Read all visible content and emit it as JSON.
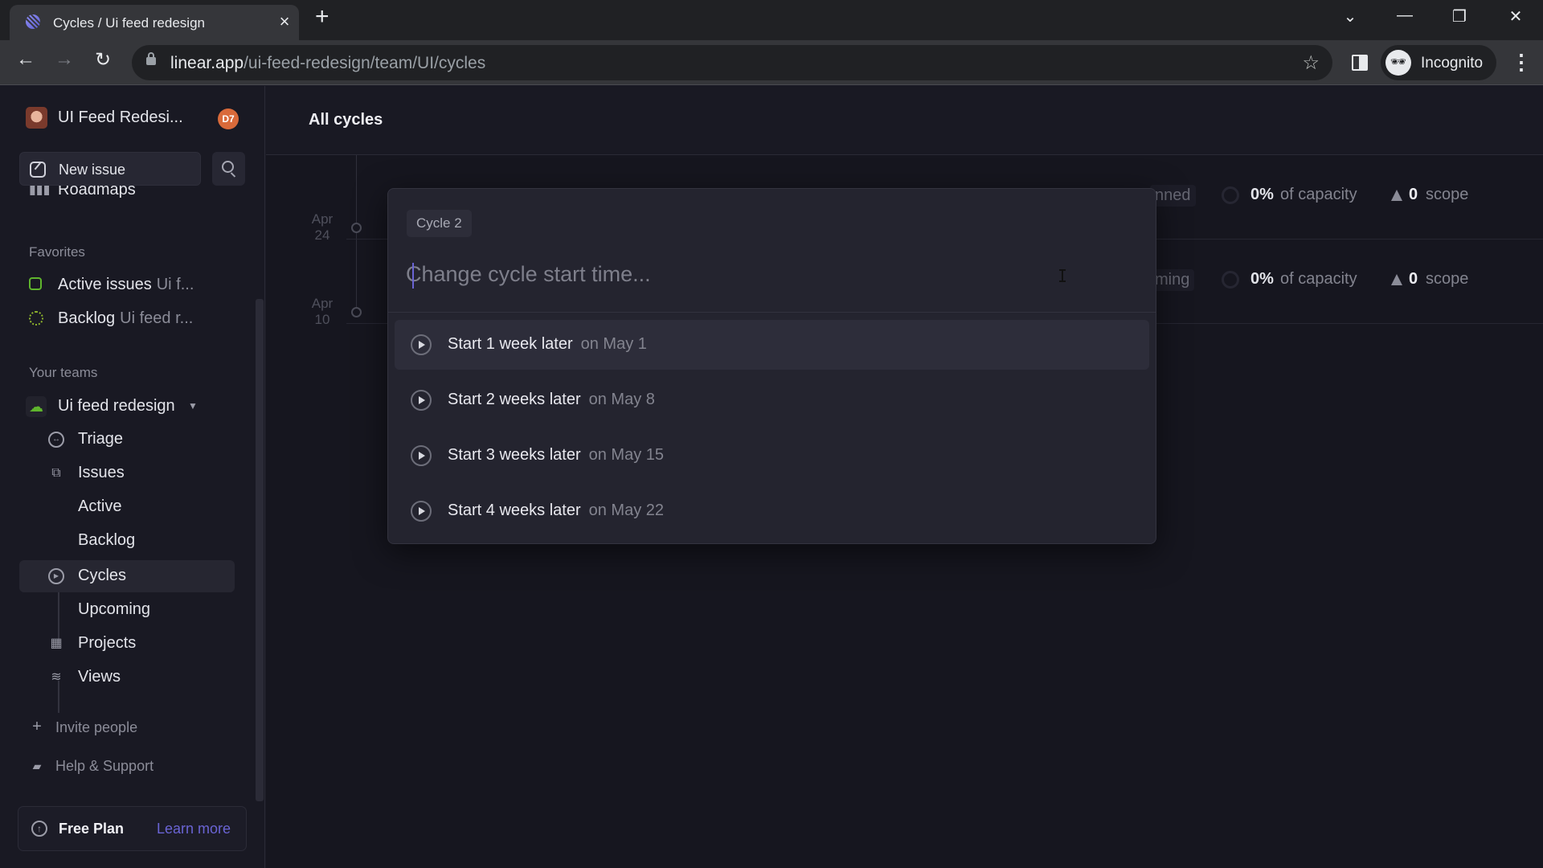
{
  "browser": {
    "tab_title": "Cycles / Ui feed redesign",
    "tab_close": "×",
    "new_tab": "+",
    "url_host": "linear.app",
    "url_path": "/ui-feed-redesign/team/UI/cycles",
    "profile_label": "Incognito",
    "controls": {
      "dropdown": "⌄",
      "minimize": "—",
      "restore": "❐",
      "close": "✕"
    },
    "nav": {
      "back": "←",
      "forward": "→",
      "reload": "↻",
      "star": "☆",
      "menu": "⋮"
    }
  },
  "sidebar": {
    "workspace_name": "UI Feed Redesi...",
    "user_badge": "D7",
    "new_issue_label": "New issue",
    "roadmaps_label": "Roadmaps",
    "favorites_heading": "Favorites",
    "favorites": [
      {
        "label": "Active issues",
        "sub": "Ui f..."
      },
      {
        "label": "Backlog",
        "sub": "Ui feed r..."
      }
    ],
    "teams_heading": "Your teams",
    "team_name": "Ui feed redesign",
    "team_items": [
      {
        "label": "Triage"
      },
      {
        "label": "Issues"
      },
      {
        "label": "Active"
      },
      {
        "label": "Backlog"
      },
      {
        "label": "Cycles",
        "active": true
      },
      {
        "label": "Upcoming"
      },
      {
        "label": "Projects"
      },
      {
        "label": "Views"
      }
    ],
    "invite_label": "Invite people",
    "help_label": "Help & Support",
    "plan_label": "Free Plan",
    "learn_more_label": "Learn more"
  },
  "main": {
    "title": "All cycles",
    "cycles": [
      {
        "month": "Apr",
        "day": "24",
        "status_partial": "nned",
        "capacity_pct": "0%",
        "capacity_text": "of capacity",
        "scope_num": "0",
        "scope_text": "scope"
      },
      {
        "month": "Apr",
        "day": "10",
        "status_partial": "ming",
        "capacity_pct": "0%",
        "capacity_text": "of capacity",
        "scope_num": "0",
        "scope_text": "scope"
      }
    ]
  },
  "modal": {
    "context_chip": "Cycle 2",
    "input_placeholder": "Change cycle start time...",
    "input_value": "",
    "options": [
      {
        "label": "Start 1 week later",
        "date": "on May 1",
        "highlighted": true
      },
      {
        "label": "Start 2 weeks later",
        "date": "on May 8"
      },
      {
        "label": "Start 3 weeks later",
        "date": "on May 15"
      },
      {
        "label": "Start 4 weeks later",
        "date": "on May 22"
      }
    ]
  },
  "colors": {
    "accent": "#6a64d4",
    "badge": "#d96a3a",
    "team_green": "#5fb52d",
    "background": "#191923"
  }
}
